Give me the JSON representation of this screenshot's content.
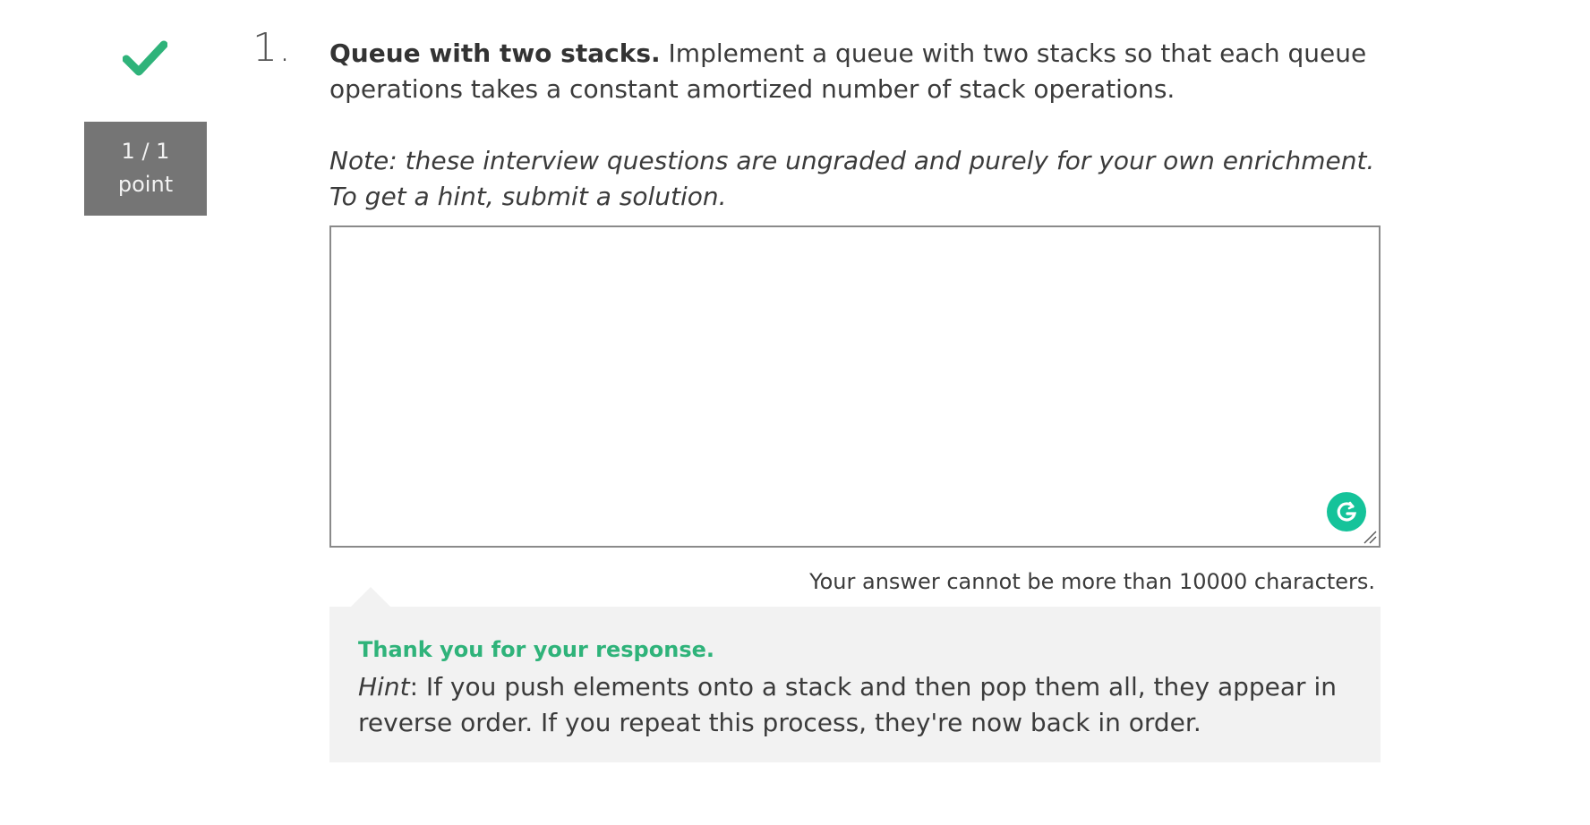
{
  "question": {
    "number": "1.",
    "score_value": "1 / 1",
    "score_unit": "point",
    "title": "Queue with two stacks.",
    "prompt": " Implement a queue with two stacks so that each queue operations takes a constant amortized number of stack operations.",
    "note": "Note: these interview questions are ungraded and purely for your own enrichment. To get a hint, submit a solution.",
    "answer_value": "",
    "char_limit_text": "Your answer cannot be more than 10000 characters."
  },
  "feedback": {
    "title": "Thank you for your response.",
    "hint_label": "Hint",
    "hint_text": ": If you push elements onto a stack and then pop them all, they appear in reverse order. If you repeat this process, they're now back in order."
  },
  "icons": {
    "status": "checkmark-icon",
    "grammarly": "grammarly-icon"
  },
  "colors": {
    "success": "#2fb37a",
    "score_bg": "#757575",
    "feedback_bg": "#f2f2f2",
    "grammarly": "#15c39a"
  }
}
